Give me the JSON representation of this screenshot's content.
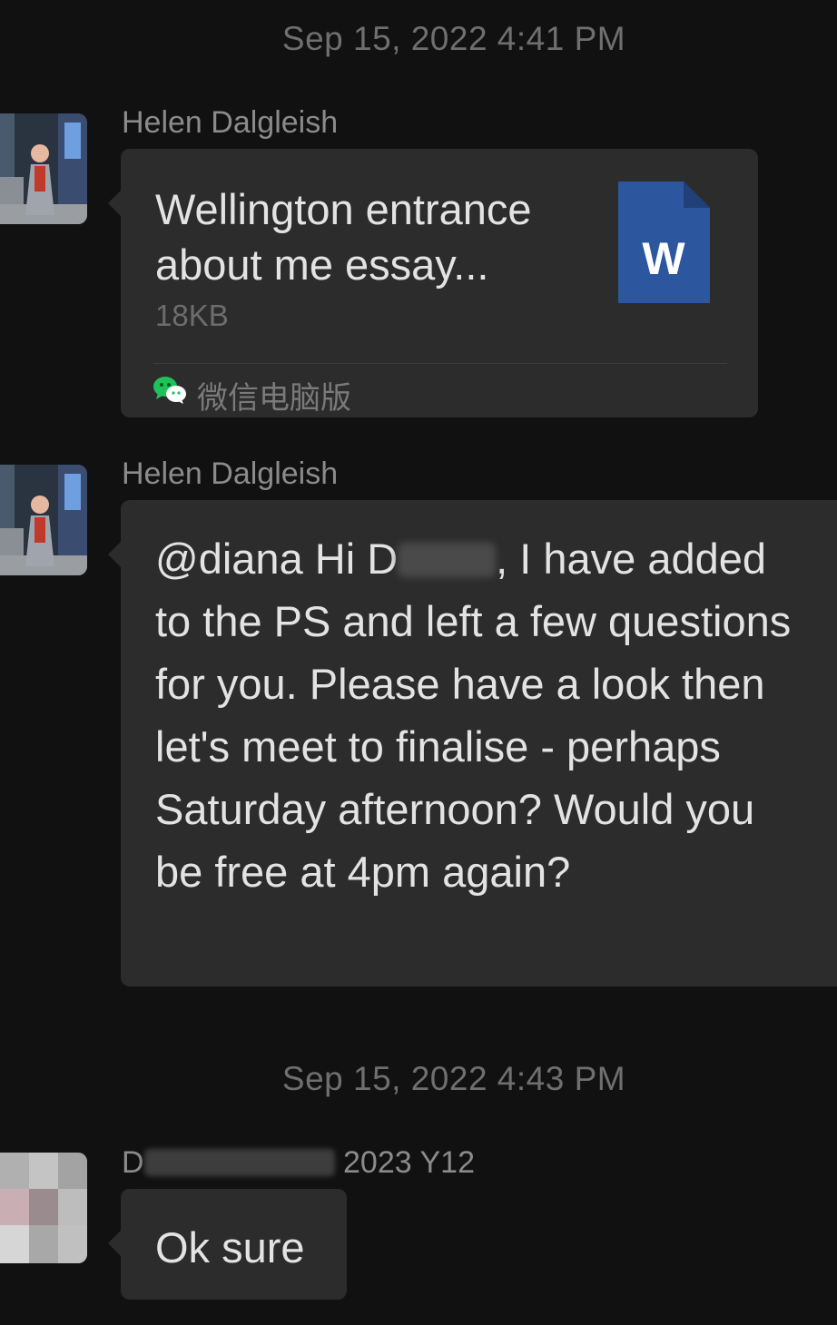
{
  "timestamps": [
    "Sep 15, 2022 4:41 PM",
    "Sep 15, 2022 4:43 PM"
  ],
  "messages": [
    {
      "sender": "Helen Dalgleish",
      "type": "file",
      "file": {
        "name": "Wellington entrance about me essay...",
        "size": "18KB",
        "icon": "word-document-icon",
        "icon_letter": "W",
        "icon_color": "#2c579e",
        "source_label": "微信电脑版",
        "source_icon": "wechat-icon"
      }
    },
    {
      "sender": "Helen Dalgleish",
      "type": "text",
      "text_part1": "@diana  Hi D",
      "text_part2": ", I have added to the PS and left a few questions for you. Please have a look then let's meet to finalise - perhaps Saturday afternoon? Would you be free at 4pm again?"
    },
    {
      "sender_prefix": "D",
      "sender_suffix": "2023 Y12",
      "type": "text",
      "text": "Ok sure"
    }
  ],
  "colors": {
    "background": "#111111",
    "bubble": "#2c2c2c",
    "timestamp": "#6f6f6f",
    "sender": "#8b8b8b",
    "text": "#e3e3e3"
  }
}
